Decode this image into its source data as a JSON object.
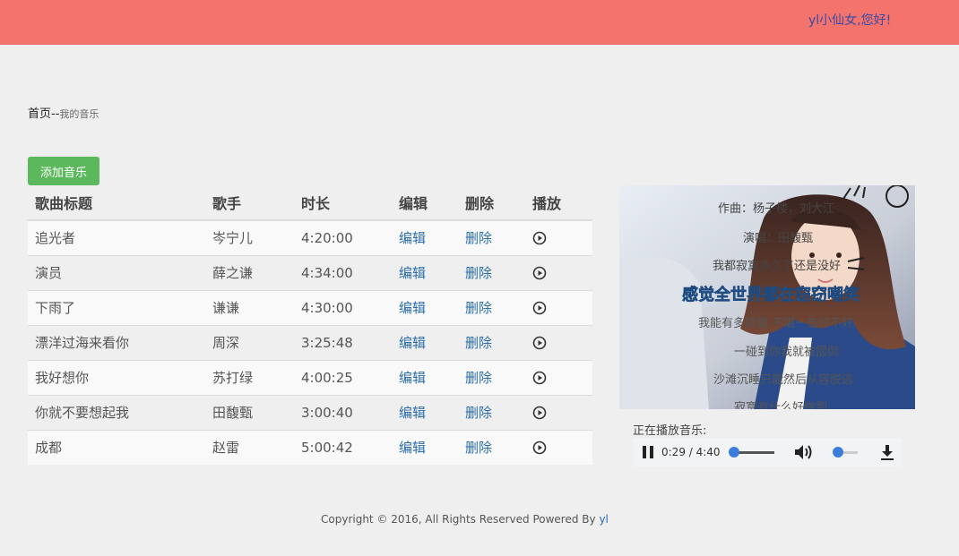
{
  "header": {
    "greeting": "yl小仙女,您好!",
    "bar_color": "#f4736c"
  },
  "breadcrumb": {
    "home": "首页",
    "separator": "--",
    "current": "我的音乐"
  },
  "actions": {
    "add_music": "添加音乐"
  },
  "table": {
    "columns": [
      "歌曲标题",
      "歌手",
      "时长",
      "编辑",
      "删除",
      "播放"
    ],
    "rows": [
      {
        "title": "追光者",
        "singer": "岑宁儿",
        "duration": "4:20:00",
        "edit": "编辑",
        "delete": "删除"
      },
      {
        "title": "演员",
        "singer": "薛之谦",
        "duration": "4:34:00",
        "edit": "编辑",
        "delete": "删除"
      },
      {
        "title": "下雨了",
        "singer": "谦谦",
        "duration": "4:30:00",
        "edit": "编辑",
        "delete": "删除"
      },
      {
        "title": "漂洋过海来看你",
        "singer": "周深",
        "duration": "3:25:48",
        "edit": "编辑",
        "delete": "删除"
      },
      {
        "title": "我好想你",
        "singer": "苏打绿",
        "duration": "4:00:25",
        "edit": "编辑",
        "delete": "删除"
      },
      {
        "title": "你就不要想起我",
        "singer": "田馥甄",
        "duration": "3:00:40",
        "edit": "编辑",
        "delete": "删除"
      },
      {
        "title": "成都",
        "singer": "赵雷",
        "duration": "5:00:42",
        "edit": "编辑",
        "delete": "删除"
      }
    ]
  },
  "cover": {
    "lyrics": [
      "作曲：杨子楼，刘大江",
      "演唱：田馥甄",
      "我都寂寞多久了还是没好",
      "感觉全世界都在窃窃嘲笑",
      "我能有多骄傲 不堪一击好不好",
      "一碰到你我就被摺倒",
      "沙滩沉睡只能然后从容脱逃",
      "寂寞有什么好做到"
    ]
  },
  "player": {
    "now_playing_label": "正在播放音乐:",
    "time": "0:29 / 4:40",
    "progress_fraction": 0.104,
    "volume_fraction": 0.1
  },
  "footer": {
    "copyright": "Copyright © 2016, All Rights Reserved Powered By",
    "author": "yl"
  }
}
